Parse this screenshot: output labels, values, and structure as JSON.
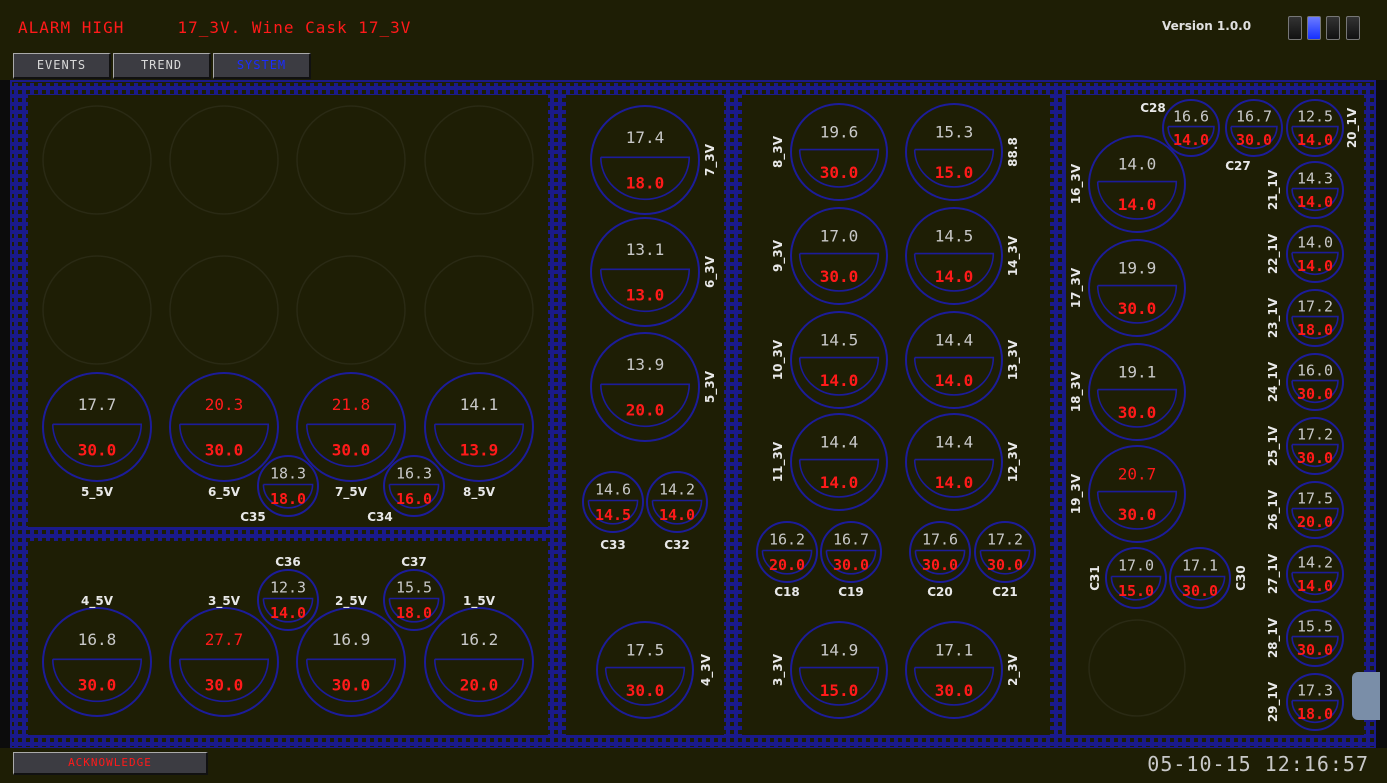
{
  "header": {
    "alarm_text": "ALARM HIGH     17_3V. Wine Cask 17_3V",
    "version": "Version 1.0.0",
    "indicators": [
      false,
      true,
      false,
      false
    ]
  },
  "nav": {
    "events": "EVENTS",
    "trend": "TREND",
    "system": "SYSTEM"
  },
  "footer": {
    "acknowledge": "ACKNOWLEDGE",
    "datetime": "05-10-15 12:16:57"
  },
  "colors": {
    "background": "#1e1e05",
    "border": "#1a1a8a",
    "alarm": "#ff1a1a",
    "value": "#c8c8c8"
  },
  "tanks": [
    {
      "label": "5_5V",
      "top": "17.7",
      "bottom": "30.0",
      "alarm": false
    },
    {
      "label": "6_5V",
      "top": "20.3",
      "bottom": "30.0",
      "alarm": true
    },
    {
      "label": "7_5V",
      "top": "21.8",
      "bottom": "30.0",
      "alarm": true
    },
    {
      "label": "8_5V",
      "top": "14.1",
      "bottom": "13.9",
      "alarm": false
    },
    {
      "label": "C35",
      "top": "18.3",
      "bottom": "18.0",
      "alarm": false
    },
    {
      "label": "C34",
      "top": "16.3",
      "bottom": "16.0",
      "alarm": false
    },
    {
      "label": "4_5V",
      "top": "16.8",
      "bottom": "30.0",
      "alarm": false
    },
    {
      "label": "3_5V",
      "top": "27.7",
      "bottom": "30.0",
      "alarm": true
    },
    {
      "label": "2_5V",
      "top": "16.9",
      "bottom": "30.0",
      "alarm": false
    },
    {
      "label": "1_5V",
      "top": "16.2",
      "bottom": "20.0",
      "alarm": false
    },
    {
      "label": "C36",
      "top": "12.3",
      "bottom": "14.0",
      "alarm": false
    },
    {
      "label": "C37",
      "top": "15.5",
      "bottom": "18.0",
      "alarm": false
    },
    {
      "label": "7_3V",
      "top": "17.4",
      "bottom": "18.0",
      "alarm": false
    },
    {
      "label": "6_3V",
      "top": "13.1",
      "bottom": "13.0",
      "alarm": false
    },
    {
      "label": "5_3V",
      "top": "13.9",
      "bottom": "20.0",
      "alarm": false
    },
    {
      "label": "C33",
      "top": "14.6",
      "bottom": "14.5",
      "alarm": false
    },
    {
      "label": "C32",
      "top": "14.2",
      "bottom": "14.0",
      "alarm": false
    },
    {
      "label": "4_3V",
      "top": "17.5",
      "bottom": "30.0",
      "alarm": false
    },
    {
      "label": "8_3V",
      "top": "19.6",
      "bottom": "30.0",
      "alarm": false
    },
    {
      "label": "88.8",
      "top": "15.3",
      "bottom": "15.0",
      "alarm": false
    },
    {
      "label": "9_3V",
      "top": "17.0",
      "bottom": "30.0",
      "alarm": false
    },
    {
      "label": "14_3V",
      "top": "14.5",
      "bottom": "14.0",
      "alarm": false
    },
    {
      "label": "10_3V",
      "top": "14.5",
      "bottom": "14.0",
      "alarm": false
    },
    {
      "label": "13_3V",
      "top": "14.4",
      "bottom": "14.0",
      "alarm": false
    },
    {
      "label": "11_3V",
      "top": "14.4",
      "bottom": "14.0",
      "alarm": false
    },
    {
      "label": "12_3V",
      "top": "14.4",
      "bottom": "14.0",
      "alarm": false
    },
    {
      "label": "C18",
      "top": "16.2",
      "bottom": "20.0",
      "alarm": false
    },
    {
      "label": "C19",
      "top": "16.7",
      "bottom": "30.0",
      "alarm": false
    },
    {
      "label": "C20",
      "top": "17.6",
      "bottom": "30.0",
      "alarm": false
    },
    {
      "label": "C21",
      "top": "17.2",
      "bottom": "30.0",
      "alarm": false
    },
    {
      "label": "3_3V",
      "top": "14.9",
      "bottom": "15.0",
      "alarm": false
    },
    {
      "label": "2_3V",
      "top": "17.1",
      "bottom": "30.0",
      "alarm": false
    },
    {
      "label": "C28",
      "top": "16.6",
      "bottom": "14.0",
      "alarm": false
    },
    {
      "label": "C27",
      "top": "16.7",
      "bottom": "30.0",
      "alarm": false
    },
    {
      "label": "16_3V",
      "top": "14.0",
      "bottom": "14.0",
      "alarm": false
    },
    {
      "label": "17_3V",
      "top": "19.9",
      "bottom": "30.0",
      "alarm": false
    },
    {
      "label": "18_3V",
      "top": "19.1",
      "bottom": "30.0",
      "alarm": false
    },
    {
      "label": "19_3V",
      "top": "20.7",
      "bottom": "30.0",
      "alarm": true
    },
    {
      "label": "C31",
      "top": "17.0",
      "bottom": "15.0",
      "alarm": false
    },
    {
      "label": "C30",
      "top": "17.1",
      "bottom": "30.0",
      "alarm": false
    },
    {
      "label": "20_1V",
      "top": "12.5",
      "bottom": "14.0",
      "alarm": false
    },
    {
      "label": "21_1V",
      "top": "14.3",
      "bottom": "14.0",
      "alarm": false
    },
    {
      "label": "22_1V",
      "top": "14.0",
      "bottom": "14.0",
      "alarm": false
    },
    {
      "label": "23_1V",
      "top": "17.2",
      "bottom": "18.0",
      "alarm": false
    },
    {
      "label": "24_1V",
      "top": "16.0",
      "bottom": "30.0",
      "alarm": false
    },
    {
      "label": "25_1V",
      "top": "17.2",
      "bottom": "30.0",
      "alarm": false
    },
    {
      "label": "26_1V",
      "top": "17.5",
      "bottom": "20.0",
      "alarm": false
    },
    {
      "label": "27_1V",
      "top": "14.2",
      "bottom": "14.0",
      "alarm": false
    },
    {
      "label": "28_1V",
      "top": "15.5",
      "bottom": "30.0",
      "alarm": false
    },
    {
      "label": "29_1V",
      "top": "17.3",
      "bottom": "18.0",
      "alarm": false
    }
  ]
}
